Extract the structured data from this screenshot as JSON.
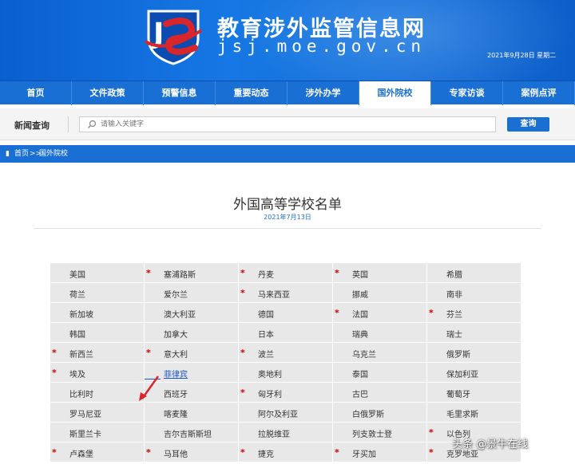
{
  "header": {
    "site_title": "教育涉外监管信息网",
    "site_domain": "jsj.moe.gov.cn",
    "date": "2021年9月28日 星期二",
    "colors": {
      "primary": "#1a6fd4",
      "logo_red": "#d8262b"
    }
  },
  "nav": {
    "items": [
      {
        "label": "首页"
      },
      {
        "label": "文件政策"
      },
      {
        "label": "预警信息"
      },
      {
        "label": "重要动态"
      },
      {
        "label": "涉外办学"
      },
      {
        "label": "国外院校"
      },
      {
        "label": "专家访谈"
      },
      {
        "label": "案例点评"
      }
    ],
    "active": "国外院校"
  },
  "search": {
    "label": "新闻查询",
    "placeholder": "请输入关键字",
    "button_label": "查询"
  },
  "breadcrumb": {
    "home": "首页",
    "separator": ">>",
    "current": "国外院校"
  },
  "main": {
    "title": "外国高等学校名单",
    "date": "2021年7月13日"
  },
  "countries": [
    {
      "name": "美国",
      "star": false
    },
    {
      "name": "塞浦路斯",
      "star": true
    },
    {
      "name": "丹麦",
      "star": true
    },
    {
      "name": "英国",
      "star": true
    },
    {
      "name": "希腊",
      "star": false
    },
    {
      "name": "荷兰",
      "star": false
    },
    {
      "name": "爱尔兰",
      "star": false
    },
    {
      "name": "马来西亚",
      "star": true
    },
    {
      "name": "挪威",
      "star": false
    },
    {
      "name": "南非",
      "star": false
    },
    {
      "name": "新加坡",
      "star": false
    },
    {
      "name": "澳大利亚",
      "star": false
    },
    {
      "name": "德国",
      "star": false
    },
    {
      "name": "法国",
      "star": true
    },
    {
      "name": "芬兰",
      "star": true
    },
    {
      "name": "韩国",
      "star": false
    },
    {
      "name": "加拿大",
      "star": false
    },
    {
      "name": "日本",
      "star": false
    },
    {
      "name": "瑞典",
      "star": false
    },
    {
      "name": "瑞士",
      "star": false
    },
    {
      "name": "新西兰",
      "star": true
    },
    {
      "name": "意大利",
      "star": true
    },
    {
      "name": "波兰",
      "star": true
    },
    {
      "name": "乌克兰",
      "star": false
    },
    {
      "name": "俄罗斯",
      "star": false
    },
    {
      "name": "埃及",
      "star": true
    },
    {
      "name": "菲律宾",
      "star": false,
      "link": true
    },
    {
      "name": "奥地利",
      "star": false
    },
    {
      "name": "泰国",
      "star": false
    },
    {
      "name": "保加利亚",
      "star": false
    },
    {
      "name": "比利时",
      "star": false
    },
    {
      "name": "西班牙",
      "star": false
    },
    {
      "name": "匈牙利",
      "star": true
    },
    {
      "name": "古巴",
      "star": false
    },
    {
      "name": "葡萄牙",
      "star": false
    },
    {
      "name": "罗马尼亚",
      "star": false
    },
    {
      "name": "喀麦隆",
      "star": false
    },
    {
      "name": "阿尔及利亚",
      "star": false
    },
    {
      "name": "白俄罗斯",
      "star": false
    },
    {
      "name": "毛里求斯",
      "star": false
    },
    {
      "name": "斯里兰卡",
      "star": false
    },
    {
      "name": "吉尔吉斯斯坦",
      "star": false
    },
    {
      "name": "拉脱维亚",
      "star": false
    },
    {
      "name": "列支敦士登",
      "star": false
    },
    {
      "name": "以色列",
      "star": true
    },
    {
      "name": "卢森堡",
      "star": true
    },
    {
      "name": "马耳他",
      "star": true
    },
    {
      "name": "捷克",
      "star": true
    },
    {
      "name": "牙买加",
      "star": true
    },
    {
      "name": "克罗地亚",
      "star": true
    }
  ],
  "watermark": "头条 @景牛在线"
}
